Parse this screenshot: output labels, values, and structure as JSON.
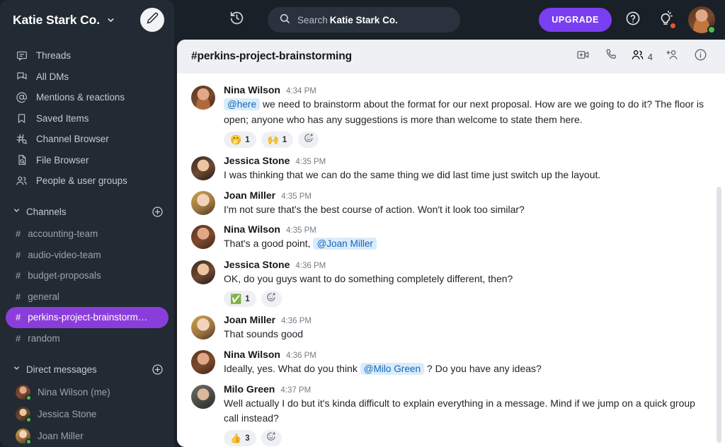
{
  "workspace": {
    "name": "Katie Stark Co.",
    "chevron_icon": "chevron-down-icon",
    "compose_icon": "pencil-icon"
  },
  "topbar": {
    "history_icon": "history-icon",
    "search_icon": "search-icon",
    "search_placeholder_prefix": "Search",
    "search_scope": "Katie Stark Co.",
    "upgrade_label": "UPGRADE",
    "help_icon": "question-circle-icon",
    "ideas_icon": "lightbulb-icon",
    "notification_dot_color": "#f0502a",
    "avatar_presence_color": "#46c44d",
    "accent_purple": "#7a3ff0"
  },
  "sidebar": {
    "nav_items": [
      {
        "label": "Threads",
        "icon": "threads-icon"
      },
      {
        "label": "All DMs",
        "icon": "all-dms-icon"
      },
      {
        "label": "Mentions & reactions",
        "icon": "at-icon"
      },
      {
        "label": "Saved Items",
        "icon": "bookmark-icon"
      },
      {
        "label": "Channel Browser",
        "icon": "channel-browser-icon"
      },
      {
        "label": "File Browser",
        "icon": "file-browser-icon"
      },
      {
        "label": "People & user groups",
        "icon": "people-icon"
      }
    ],
    "channels_section": {
      "label": "Channels",
      "caret_icon": "chevron-down-icon",
      "add_icon": "plus-circle-icon",
      "items": [
        {
          "label": "accounting-team",
          "active": false
        },
        {
          "label": "audio-video-team",
          "active": false
        },
        {
          "label": "budget-proposals",
          "active": false
        },
        {
          "label": "general",
          "active": false
        },
        {
          "label": "perkins-project-brainstorm…",
          "active": true
        },
        {
          "label": "random",
          "active": false
        }
      ],
      "active_color": "#8b3ddb"
    },
    "dm_section": {
      "label": "Direct messages",
      "caret_icon": "chevron-down-icon",
      "add_icon": "plus-circle-icon",
      "items": [
        {
          "label": "Nina Wilson (me)",
          "avatar": "nina",
          "online": true
        },
        {
          "label": "Jessica Stone",
          "avatar": "jessica",
          "online": true
        },
        {
          "label": "Joan Miller",
          "avatar": "joan",
          "online": true
        }
      ]
    }
  },
  "channel": {
    "title": "#perkins-project-brainstorming",
    "actions": {
      "video_icon": "video-call-icon",
      "phone_icon": "phone-call-icon",
      "members_icon": "members-icon",
      "member_count": "4",
      "add_member_icon": "add-person-icon",
      "info_icon": "info-circle-icon"
    }
  },
  "messages": [
    {
      "author": "Nina Wilson",
      "time": "4:34 PM",
      "avatar": "nina",
      "mention_leading": "@here",
      "text": "we need to brainstorm about the format for our next proposal. How are we going to do it? The floor is open; anyone who has any suggestions is more than welcome to state them here.",
      "reactions": [
        {
          "emoji": "🤭",
          "count": "1"
        },
        {
          "emoji": "🙌",
          "count": "1"
        }
      ],
      "has_add_reaction": true
    },
    {
      "author": "Jessica Stone",
      "time": "4:35 PM",
      "avatar": "jessica",
      "text": "I was thinking that we can do the same thing we did last time just switch up the layout.",
      "reactions": [],
      "has_add_reaction": false
    },
    {
      "author": "Joan Miller",
      "time": "4:35 PM",
      "avatar": "joan",
      "text": "I'm not sure that's the best course of action. Won't it look too similar?",
      "reactions": [],
      "has_add_reaction": false
    },
    {
      "author": "Nina Wilson",
      "time": "4:35 PM",
      "avatar": "nina",
      "text": "That's a good point,",
      "mention_trailing": "@Joan Miller",
      "reactions": [],
      "has_add_reaction": false
    },
    {
      "author": "Jessica Stone",
      "time": "4:36 PM",
      "avatar": "jessica",
      "text": "OK, do you guys want to do something completely different, then?",
      "reactions": [
        {
          "emoji": "✅",
          "count": "1"
        }
      ],
      "has_add_reaction": true
    },
    {
      "author": "Joan Miller",
      "time": "4:36 PM",
      "avatar": "joan",
      "text": "That sounds good",
      "reactions": [],
      "has_add_reaction": false
    },
    {
      "author": "Nina Wilson",
      "time": "4:36 PM",
      "avatar": "nina",
      "text": "Ideally, yes. What do you think",
      "mention_inline": "@Milo Green",
      "text_after": "? Do you have any ideas?",
      "reactions": [],
      "has_add_reaction": false
    },
    {
      "author": "Milo Green",
      "time": "4:37 PM",
      "avatar": "milo",
      "text": "Well actually I do but it's kinda difficult to explain everything in a message. Mind if we jump on a quick group call instead?",
      "reactions": [
        {
          "emoji": "👍",
          "count": "3"
        }
      ],
      "has_add_reaction": true
    }
  ]
}
